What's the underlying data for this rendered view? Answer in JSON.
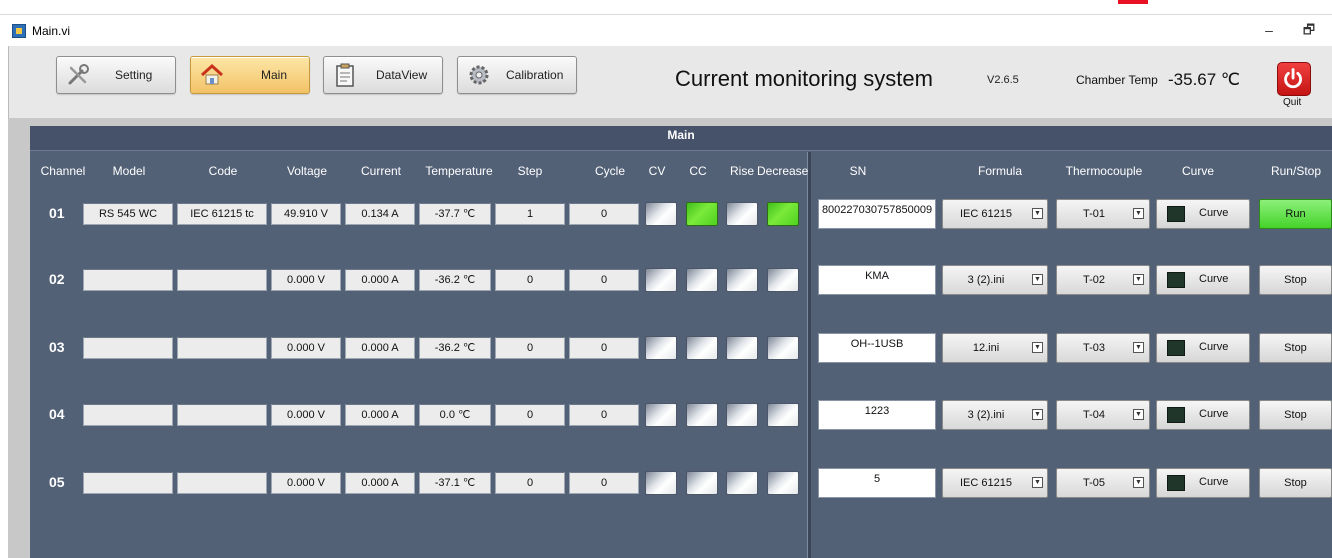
{
  "window": {
    "title": "Main.vi",
    "minimize": "–",
    "restore": "🗗"
  },
  "toolbar": {
    "buttons": [
      {
        "label": "Setting",
        "icon": "tools-icon"
      },
      {
        "label": "Main",
        "icon": "home-icon",
        "active": true
      },
      {
        "label": "DataView",
        "icon": "clipboard-icon"
      },
      {
        "label": "Calibration",
        "icon": "gear-icon"
      }
    ],
    "app_title": "Current monitoring system",
    "version": "V2.6.5",
    "chamber_label": "Chamber Temp",
    "chamber_value": "-35.67 ℃",
    "quit_label": "Quit"
  },
  "panel": {
    "title": "Main",
    "headers": [
      "Channel",
      "Model",
      "Code",
      "Voltage",
      "Current",
      "Temperature",
      "Step",
      "Cycle",
      "CV",
      "CC",
      "Rise",
      "Decrease",
      "SN",
      "Formula",
      "Thermocouple",
      "Curve",
      "Run/Stop"
    ],
    "curve_label": "Curve",
    "channels": [
      {
        "num": "01",
        "model": "RS 545 WC",
        "code": "IEC 61215 tc",
        "voltage": "49.910 V",
        "current": "0.134 A",
        "temperature": "-37.7 ℃",
        "step": "1",
        "cycle": "0",
        "leds": [
          false,
          true,
          false,
          true
        ],
        "sn": "800227030757850009",
        "formula": "IEC 61215",
        "thermocouple": "T-01",
        "run": "Run",
        "running": true
      },
      {
        "num": "02",
        "model": "",
        "code": "",
        "voltage": "0.000 V",
        "current": "0.000 A",
        "temperature": "-36.2 ℃",
        "step": "0",
        "cycle": "0",
        "leds": [
          false,
          false,
          false,
          false
        ],
        "sn": "KMA",
        "formula": "3 (2).ini",
        "thermocouple": "T-02",
        "run": "Stop",
        "running": false
      },
      {
        "num": "03",
        "model": "",
        "code": "",
        "voltage": "0.000 V",
        "current": "0.000 A",
        "temperature": "-36.2 ℃",
        "step": "0",
        "cycle": "0",
        "leds": [
          false,
          false,
          false,
          false
        ],
        "sn": "OH--1USB",
        "formula": "12.ini",
        "thermocouple": "T-03",
        "run": "Stop",
        "running": false
      },
      {
        "num": "04",
        "model": "",
        "code": "",
        "voltage": "0.000 V",
        "current": "0.000 A",
        "temperature": "0.0 ℃",
        "step": "0",
        "cycle": "0",
        "leds": [
          false,
          false,
          false,
          false
        ],
        "sn": "1223",
        "formula": "3 (2).ini",
        "thermocouple": "T-04",
        "run": "Stop",
        "running": false
      },
      {
        "num": "05",
        "model": "",
        "code": "",
        "voltage": "0.000 V",
        "current": "0.000 A",
        "temperature": "-37.1 ℃",
        "step": "0",
        "cycle": "0",
        "leds": [
          false,
          false,
          false,
          false
        ],
        "sn": "5",
        "formula": "IEC 61215",
        "thermocouple": "T-05",
        "run": "Stop",
        "running": false
      }
    ]
  },
  "colors": {
    "panel_bg": "#536177",
    "led_on": "#5cd82a",
    "run_on": "#45d32a",
    "quit": "#d42020"
  }
}
